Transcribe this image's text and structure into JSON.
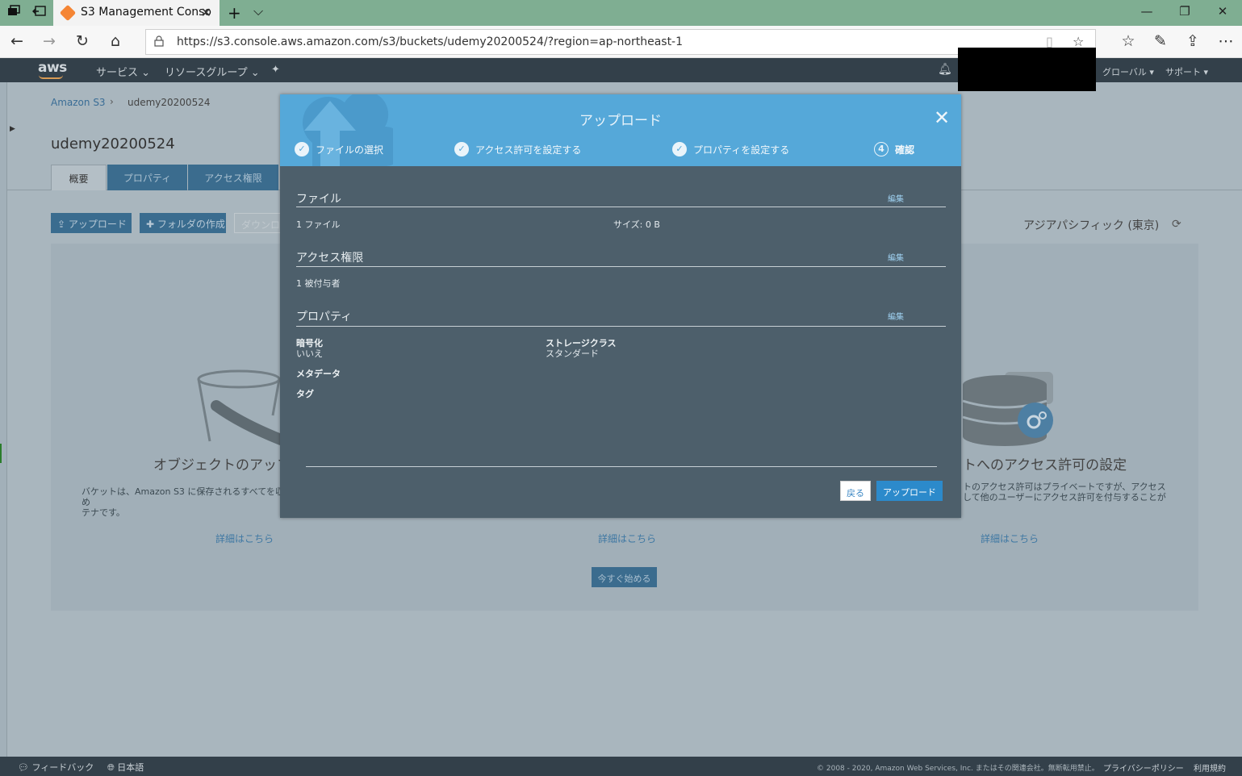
{
  "browser": {
    "tab_title": "S3 Management Conso",
    "url": "https://s3.console.aws.amazon.com/s3/buckets/udemy20200524/?region=ap-northeast-1"
  },
  "aws_header": {
    "logo": "aws",
    "services": "サービス ⌄",
    "resource_groups": "リソースグループ ⌄",
    "region_menu": "グローバル ▾",
    "support_menu": "サポート ▾"
  },
  "breadcrumb": {
    "root": "Amazon S3",
    "current": "udemy20200524"
  },
  "bucket": {
    "title": "udemy20200524",
    "tabs": [
      "概要",
      "プロパティ",
      "アクセス権限"
    ],
    "actions": {
      "upload": "アップロード",
      "create_folder": "フォルダの作成",
      "download": "ダウンロー"
    },
    "region": "アジアパシフィック (東京)"
  },
  "cards": {
    "left_title": "オブジェクトのアッフ",
    "left_desc": "バケットは、Amazon S3 に保存されるすべてを収め\nテナです。",
    "right_title": "トへのアクセス許可の設定",
    "right_desc": "トのアクセス許可はプライベートですが、アクセス\nして他のユーザーにアクセス許可を付与することが",
    "more_label": "詳細はこちら",
    "start_button": "今すぐ始める"
  },
  "footer": {
    "feedback": "フィードバック",
    "language": "日本語",
    "copyright": "© 2008 - 2020, Amazon Web Services, Inc. またはその関連会社。無断転用禁止。",
    "privacy": "プライバシーポリシー",
    "terms": "利用規約"
  },
  "modal": {
    "title": "アップロード",
    "steps": [
      {
        "label": "ファイルの選択",
        "state": "done"
      },
      {
        "label": "アクセス許可を設定する",
        "state": "done"
      },
      {
        "label": "プロパティを設定する",
        "state": "done"
      },
      {
        "label": "確認",
        "state": "current",
        "number": "4"
      }
    ],
    "edit_label": "編集",
    "files": {
      "title": "ファイル",
      "count": "1 ファイル",
      "size": "サイズ: 0 B"
    },
    "permissions": {
      "title": "アクセス権限",
      "grantees": "1 被付与者"
    },
    "properties": {
      "title": "プロパティ",
      "encryption_label": "暗号化",
      "encryption_value": "いいえ",
      "storage_class_label": "ストレージクラス",
      "storage_class_value": "スタンダード",
      "metadata_label": "メタデータ",
      "tags_label": "タグ"
    },
    "back_button": "戻る",
    "upload_button": "アップロード"
  },
  "colors": {
    "modal_header": "#55a8d9",
    "modal_body": "#4d5f6b",
    "aws_header": "#33404a",
    "primary_button": "#2c8acb"
  }
}
